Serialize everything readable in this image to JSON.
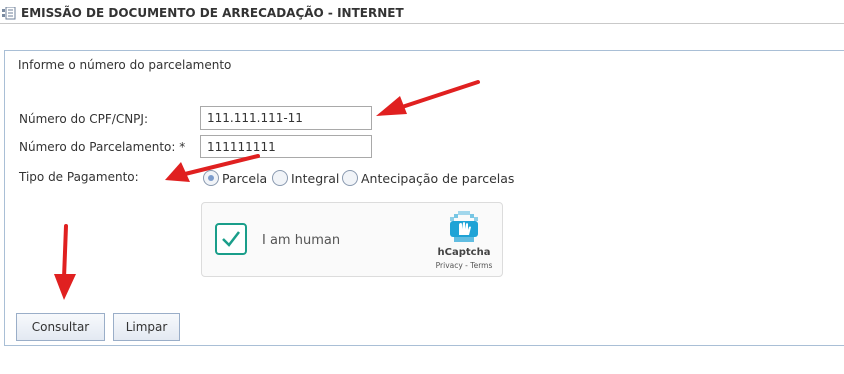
{
  "header": {
    "title": "EMISSÃO DE DOCUMENTO DE ARRECADAÇÃO - INTERNET"
  },
  "form": {
    "legend": "Informe o número do parcelamento",
    "cpf": {
      "label": "Número do CPF/CNPJ:",
      "value": "111.111.111-11"
    },
    "parcelamento": {
      "label": "Número do Parcelamento: *",
      "value": "111111111"
    },
    "tipo_pagamento": {
      "label": "Tipo de Pagamento:",
      "selected": "Parcela",
      "options": [
        "Parcela",
        "Integral",
        "Antecipação de parcelas"
      ]
    }
  },
  "captcha": {
    "text": "I am human",
    "brand": "hCaptcha",
    "links": "Privacy - Terms",
    "checked": true
  },
  "buttons": {
    "consultar": "Consultar",
    "limpar": "Limpar"
  },
  "annotations": {
    "arrow_color": "#e02020"
  },
  "colors": {
    "panel_border": "#a9bfd6",
    "captcha_accent": "#1a9e8a",
    "logo_blue": "#1fa3d6"
  }
}
